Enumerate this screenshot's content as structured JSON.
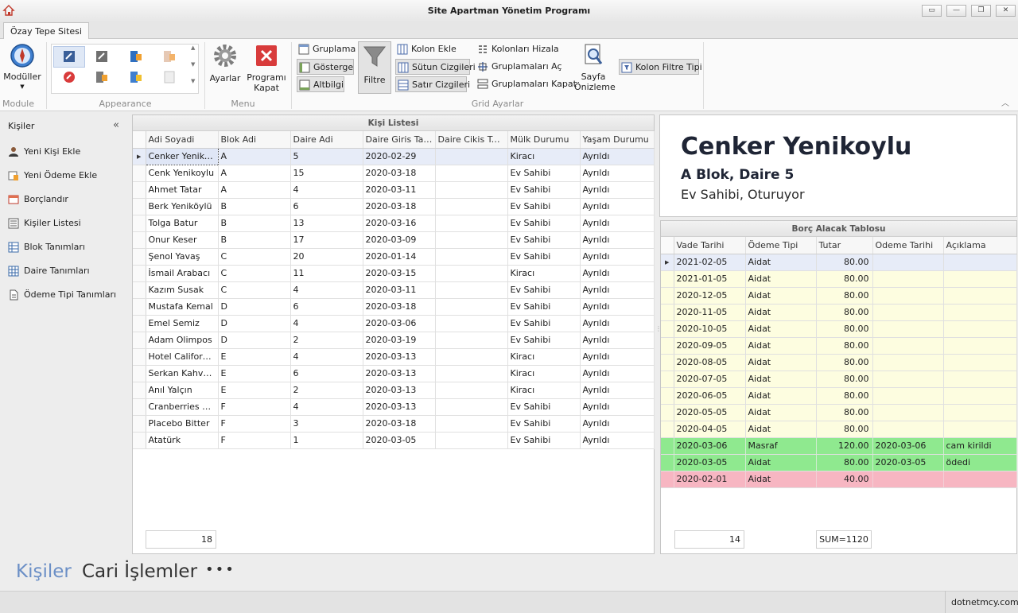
{
  "window": {
    "title": "Site Apartman Yönetim Programı",
    "tab": "Özay Tepe Sitesi"
  },
  "ribbon": {
    "moduller_label": "Modüller",
    "ayarlar_label": "Ayarlar",
    "kapat_label1": "Programı",
    "kapat_label2": "Kapat",
    "filtre_label": "Filtre",
    "sayfa_label1": "Sayfa",
    "sayfa_label2": "Önizleme",
    "gruplama": "Gruplama",
    "gosterge": "Gösterge",
    "altbilgi": "Altbilgi",
    "kolon_ekle": "Kolon Ekle",
    "sutun_cizgileri": "Sütun Cizgileri",
    "satir_cizgileri": "Satır Cizgileri",
    "kolonlari_hizala": "Kolonları Hizala",
    "gruplamalari_ac": "Gruplamaları Aç",
    "gruplamalari_kapat": "Gruplamaları Kapat",
    "kolon_filtre_tipi": "Kolon Filtre Tipi",
    "groups": {
      "module": "Module",
      "appearance": "Appearance",
      "menu": "Menu",
      "grid": "Grid Ayarlar"
    }
  },
  "sidebar": {
    "title": "Kişiler",
    "items": [
      {
        "label": "Yeni Kişi Ekle"
      },
      {
        "label": "Yeni Ödeme Ekle"
      },
      {
        "label": "Borçlandır"
      },
      {
        "label": "Kişiler Listesi"
      },
      {
        "label": "Blok Tanımları"
      },
      {
        "label": "Daire Tanımları"
      },
      {
        "label": "Ödeme Tipi Tanımları"
      }
    ]
  },
  "persons": {
    "title": "Kişi Listesi",
    "columns": [
      "Adi Soyadi",
      "Blok Adi",
      "Daire Adi",
      "Daire Giris Tarihi",
      "Daire Cikis Tarihi",
      "Mülk Durumu",
      "Yaşam Durumu"
    ],
    "rows": [
      [
        "Cenker Yenikoylu",
        "A",
        "5",
        "2020-02-29",
        "",
        "Kiracı",
        "Ayrıldı"
      ],
      [
        "Cenk Yenikoylu",
        "A",
        "15",
        "2020-03-18",
        "",
        "Ev Sahibi",
        "Ayrıldı"
      ],
      [
        "Ahmet Tatar",
        "A",
        "4",
        "2020-03-11",
        "",
        "Ev Sahibi",
        "Ayrıldı"
      ],
      [
        "Berk Yeniköylü",
        "B",
        "6",
        "2020-03-18",
        "",
        "Ev Sahibi",
        "Ayrıldı"
      ],
      [
        "Tolga Batur",
        "B",
        "13",
        "2020-03-16",
        "",
        "Ev Sahibi",
        "Ayrıldı"
      ],
      [
        "Onur Keser",
        "B",
        "17",
        "2020-03-09",
        "",
        "Ev Sahibi",
        "Ayrıldı"
      ],
      [
        "Şenol Yavaş",
        "C",
        "20",
        "2020-01-14",
        "",
        "Ev Sahibi",
        "Ayrıldı"
      ],
      [
        "İsmail Arabacı",
        "C",
        "11",
        "2020-03-15",
        "",
        "Kiracı",
        "Ayrıldı"
      ],
      [
        "Kazım Susak",
        "C",
        "4",
        "2020-03-11",
        "",
        "Ev Sahibi",
        "Ayrıldı"
      ],
      [
        "Mustafa Kemal",
        "D",
        "6",
        "2020-03-18",
        "",
        "Ev Sahibi",
        "Ayrıldı"
      ],
      [
        "Emel Semiz",
        "D",
        "4",
        "2020-03-06",
        "",
        "Ev Sahibi",
        "Ayrıldı"
      ],
      [
        "Adam Olimpos",
        "D",
        "2",
        "2020-03-19",
        "",
        "Ev Sahibi",
        "Ayrıldı"
      ],
      [
        "Hotel California",
        "E",
        "4",
        "2020-03-13",
        "",
        "Kiracı",
        "Ayrıldı"
      ],
      [
        "Serkan Kahveci",
        "E",
        "6",
        "2020-03-13",
        "",
        "Kiracı",
        "Ayrıldı"
      ],
      [
        "Anıl Yalçın",
        "E",
        "2",
        "2020-03-13",
        "",
        "Kiracı",
        "Ayrıldı"
      ],
      [
        "Cranberries Pr...",
        "F",
        "4",
        "2020-03-13",
        "",
        "Ev Sahibi",
        "Ayrıldı"
      ],
      [
        "Placebo Bitter",
        "F",
        "3",
        "2020-03-18",
        "",
        "Ev Sahibi",
        "Ayrıldı"
      ],
      [
        "Atatürk",
        "F",
        "1",
        "2020-03-05",
        "",
        "Ev Sahibi",
        "Ayrıldı"
      ]
    ],
    "footer_count": "18"
  },
  "detail": {
    "name": "Cenker Yenikoylu",
    "block": "A Blok, Daire 5",
    "status": "Ev Sahibi, Oturuyor"
  },
  "debts": {
    "title": "Borç Alacak Tablosu",
    "columns": [
      "Vade Tarihi",
      "Ödeme Tipi",
      "Tutar",
      "Odeme Tarihi",
      "Açıklama"
    ],
    "rows": [
      {
        "v": [
          "2021-02-05",
          "Aidat",
          "80.00",
          "",
          ""
        ],
        "s": "first"
      },
      {
        "v": [
          "2021-01-05",
          "Aidat",
          "80.00",
          "",
          ""
        ],
        "s": "yellow"
      },
      {
        "v": [
          "2020-12-05",
          "Aidat",
          "80.00",
          "",
          ""
        ],
        "s": "yellow"
      },
      {
        "v": [
          "2020-11-05",
          "Aidat",
          "80.00",
          "",
          ""
        ],
        "s": "yellow"
      },
      {
        "v": [
          "2020-10-05",
          "Aidat",
          "80.00",
          "",
          ""
        ],
        "s": "yellow"
      },
      {
        "v": [
          "2020-09-05",
          "Aidat",
          "80.00",
          "",
          ""
        ],
        "s": "yellow"
      },
      {
        "v": [
          "2020-08-05",
          "Aidat",
          "80.00",
          "",
          ""
        ],
        "s": "yellow"
      },
      {
        "v": [
          "2020-07-05",
          "Aidat",
          "80.00",
          "",
          ""
        ],
        "s": "yellow"
      },
      {
        "v": [
          "2020-06-05",
          "Aidat",
          "80.00",
          "",
          ""
        ],
        "s": "yellow"
      },
      {
        "v": [
          "2020-05-05",
          "Aidat",
          "80.00",
          "",
          ""
        ],
        "s": "yellow"
      },
      {
        "v": [
          "2020-04-05",
          "Aidat",
          "80.00",
          "",
          ""
        ],
        "s": "yellow"
      },
      {
        "v": [
          "2020-03-06",
          "Masraf",
          "120.00",
          "2020-03-06",
          "cam kirildi"
        ],
        "s": "green"
      },
      {
        "v": [
          "2020-03-05",
          "Aidat",
          "80.00",
          "2020-03-05",
          "ödedi"
        ],
        "s": "green"
      },
      {
        "v": [
          "2020-02-01",
          "Aidat",
          "40.00",
          "",
          ""
        ],
        "s": "pink"
      }
    ],
    "footer_count": "14",
    "footer_sum": "SUM=1120"
  },
  "bottom_nav": {
    "kisiler": "Kişiler",
    "cari": "Cari İşlemler",
    "more": "•••"
  },
  "status": {
    "right": "dotnetmcy.com"
  },
  "colors": {
    "accent": "#6b8fc6",
    "yellow_row": "#fdfde0",
    "green_row": "#8fe98f",
    "pink_row": "#f7b6c2"
  }
}
